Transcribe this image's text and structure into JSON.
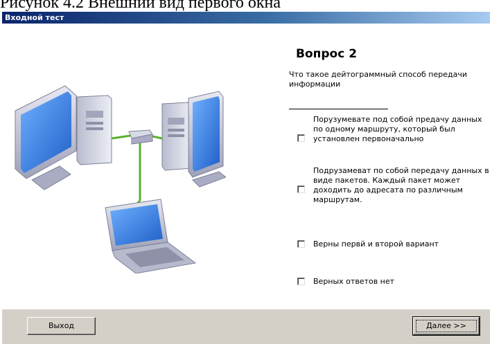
{
  "caption": "Рисунок 4.2 Внешний вид первого окна",
  "window": {
    "title": "Входной тест"
  },
  "question": {
    "title": "Вопрос 2",
    "text": "Что такое дейтограммный способ передачи информации"
  },
  "options": [
    {
      "label": "Порузумевате под собой предачу данных по одному маршруту, который был установлен первоначально",
      "checked": false
    },
    {
      "label": "Подрузамеват по собой передачу данных в виде пакетов. Каждый пакет может доходить до адресата по различным маршрутам.",
      "checked": false
    },
    {
      "label": "Верны первй и второй вариант",
      "checked": false
    },
    {
      "label": "Верных ответов нет",
      "checked": false
    }
  ],
  "buttons": {
    "exit": "Выход",
    "next": "Далее >>"
  },
  "colors": {
    "title_bar_start": "#0a246a",
    "title_bar_end": "#a6caf0",
    "panel": "#d4d0c8",
    "monitor_screen": "#2f7fe0",
    "case": "#c8cad6"
  },
  "illustration": {
    "icons": [
      "desktop-computer-icon",
      "desktop-computer-icon",
      "network-hub-icon",
      "laptop-icon"
    ]
  }
}
